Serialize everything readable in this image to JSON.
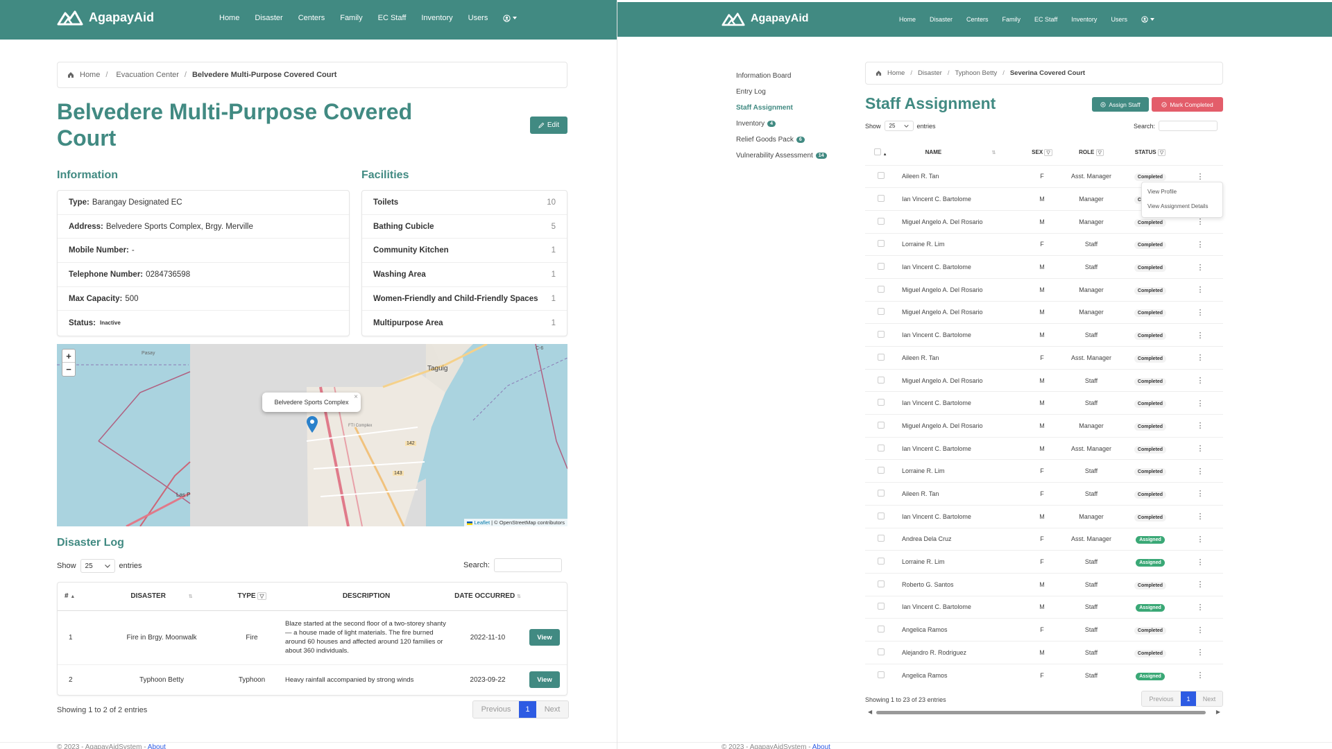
{
  "left": {
    "brand": "AgapayAid",
    "nav": [
      "Home",
      "Disaster",
      "Centers",
      "Family",
      "EC Staff",
      "Inventory",
      "Users"
    ],
    "breadcrumb": [
      "Home",
      "Evacuation Center",
      "Belvedere Multi-Purpose Covered Court"
    ],
    "title_line1": "Belvedere Multi-Purpose Covered",
    "title_line2": "Court",
    "edit_label": "Edit",
    "information": {
      "heading": "Information",
      "rows": [
        {
          "label": "Type:",
          "value": "Barangay Designated EC"
        },
        {
          "label": "Address:",
          "value": "Belvedere Sports Complex, Brgy. Merville"
        },
        {
          "label": "Mobile Number:",
          "value": "-"
        },
        {
          "label": "Telephone Number:",
          "value": "0284736598"
        },
        {
          "label": "Max Capacity:",
          "value": "500"
        },
        {
          "label": "Status:",
          "value": "Inactive"
        }
      ]
    },
    "facilities": {
      "heading": "Facilities",
      "rows": [
        {
          "name": "Toilets",
          "count": "10"
        },
        {
          "name": "Bathing Cubicle",
          "count": "5"
        },
        {
          "name": "Community Kitchen",
          "count": "1"
        },
        {
          "name": "Washing Area",
          "count": "1"
        },
        {
          "name": "Women-Friendly and Child-Friendly Spaces",
          "count": "1"
        },
        {
          "name": "Multipurpose Area",
          "count": "1"
        }
      ]
    },
    "map": {
      "popup": "Belvedere Sports Complex",
      "zoom_in": "+",
      "zoom_out": "−",
      "label_taguig": "Taguig",
      "label_pasay": "Pasay",
      "label_las": "Las P",
      "label_road_142": "142",
      "label_road_143": "143",
      "label_fti": "FTI Complex",
      "label_c6": "C-6",
      "attribution_leaflet": "Leaflet",
      "attribution_rest": " | © OpenStreetMap contributors"
    },
    "disaster_log": {
      "heading": "Disaster Log",
      "show": "Show",
      "entries_value": "25",
      "entries": "entries",
      "search": "Search:",
      "columns": [
        "#",
        "DISASTER",
        "TYPE",
        "DESCRIPTION",
        "DATE OCCURRED"
      ],
      "rows": [
        {
          "num": "1",
          "disaster": "Fire in Brgy. Moonwalk",
          "type": "Fire",
          "description": "Blaze started at the second floor of a two-storey shanty — a house made of light materials. The fire burned around 60 houses and affected around 120 families or about 360 individuals.",
          "date": "2022-11-10",
          "action": "View"
        },
        {
          "num": "2",
          "disaster": "Typhoon Betty",
          "type": "Typhoon",
          "description": "Heavy rainfall accompanied by strong winds",
          "date": "2023-09-22",
          "action": "View"
        }
      ],
      "showing": "Showing 1 to 2 of 2 entries",
      "prev": "Previous",
      "page": "1",
      "next": "Next"
    },
    "footer_text": "© 2023 - AgapayAidSystem - ",
    "footer_link": "About"
  },
  "right": {
    "brand": "AgapayAid",
    "nav": [
      "Home",
      "Disaster",
      "Centers",
      "Family",
      "EC Staff",
      "Inventory",
      "Users"
    ],
    "sidebar": [
      {
        "label": "Information Board",
        "badge": ""
      },
      {
        "label": "Entry Log",
        "badge": ""
      },
      {
        "label": "Staff Assignment",
        "badge": ""
      },
      {
        "label": "Inventory",
        "badge": "4"
      },
      {
        "label": "Relief Goods Pack",
        "badge": "6"
      },
      {
        "label": "Vulnerability Assessment",
        "badge": "14"
      }
    ],
    "breadcrumb": [
      "Home",
      "Disaster",
      "Typhoon Betty",
      "Severina Covered Court"
    ],
    "title": "Staff Assignment",
    "assign_label": "Assign Staff",
    "mark_label": "Mark Completed",
    "show": "Show",
    "entries_value": "25",
    "entries": "entries",
    "search": "Search:",
    "columns": [
      "NAME",
      "SEX",
      "ROLE",
      "STATUS"
    ],
    "rows": [
      {
        "name": "Aileen R. Tan",
        "sex": "F",
        "role": "Asst. Manager",
        "status": "Completed"
      },
      {
        "name": "Ian Vincent C. Bartolome",
        "sex": "M",
        "role": "Manager",
        "status": "Completed"
      },
      {
        "name": "Miguel Angelo A. Del Rosario",
        "sex": "M",
        "role": "Manager",
        "status": "Completed"
      },
      {
        "name": "Lorraine R. Lim",
        "sex": "F",
        "role": "Staff",
        "status": "Completed"
      },
      {
        "name": "Ian Vincent C. Bartolome",
        "sex": "M",
        "role": "Staff",
        "status": "Completed"
      },
      {
        "name": "Miguel Angelo A. Del Rosario",
        "sex": "M",
        "role": "Manager",
        "status": "Completed"
      },
      {
        "name": "Miguel Angelo A. Del Rosario",
        "sex": "M",
        "role": "Manager",
        "status": "Completed"
      },
      {
        "name": "Ian Vincent C. Bartolome",
        "sex": "M",
        "role": "Staff",
        "status": "Completed"
      },
      {
        "name": "Aileen R. Tan",
        "sex": "F",
        "role": "Asst. Manager",
        "status": "Completed"
      },
      {
        "name": "Miguel Angelo A. Del Rosario",
        "sex": "M",
        "role": "Staff",
        "status": "Completed"
      },
      {
        "name": "Ian Vincent C. Bartolome",
        "sex": "M",
        "role": "Staff",
        "status": "Completed"
      },
      {
        "name": "Miguel Angelo A. Del Rosario",
        "sex": "M",
        "role": "Manager",
        "status": "Completed"
      },
      {
        "name": "Ian Vincent C. Bartolome",
        "sex": "M",
        "role": "Asst. Manager",
        "status": "Completed"
      },
      {
        "name": "Lorraine R. Lim",
        "sex": "F",
        "role": "Staff",
        "status": "Completed"
      },
      {
        "name": "Aileen R. Tan",
        "sex": "F",
        "role": "Staff",
        "status": "Completed"
      },
      {
        "name": "Ian Vincent C. Bartolome",
        "sex": "M",
        "role": "Manager",
        "status": "Completed"
      },
      {
        "name": "Andrea Dela Cruz",
        "sex": "F",
        "role": "Asst. Manager",
        "status": "Assigned"
      },
      {
        "name": "Lorraine R. Lim",
        "sex": "F",
        "role": "Staff",
        "status": "Assigned"
      },
      {
        "name": "Roberto G. Santos",
        "sex": "M",
        "role": "Staff",
        "status": "Completed"
      },
      {
        "name": "Ian Vincent C. Bartolome",
        "sex": "M",
        "role": "Staff",
        "status": "Assigned"
      },
      {
        "name": "Angelica Ramos",
        "sex": "F",
        "role": "Staff",
        "status": "Completed"
      },
      {
        "name": "Alejandro R. Rodriguez",
        "sex": "M",
        "role": "Staff",
        "status": "Completed"
      },
      {
        "name": "Angelica Ramos",
        "sex": "F",
        "role": "Staff",
        "status": "Assigned"
      }
    ],
    "dropdown": [
      "View Profile",
      "View Assignment Details"
    ],
    "showing": "Showing 1 to 23 of 23 entries",
    "prev": "Previous",
    "page": "1",
    "next": "Next",
    "footer_text": "© 2023 - AgapayAidSystem - ",
    "footer_link": "About"
  },
  "colors": {
    "primary": "#418a82",
    "danger": "#e35d6a",
    "active_page": "#2d5be3",
    "assigned": "#3aa876"
  }
}
